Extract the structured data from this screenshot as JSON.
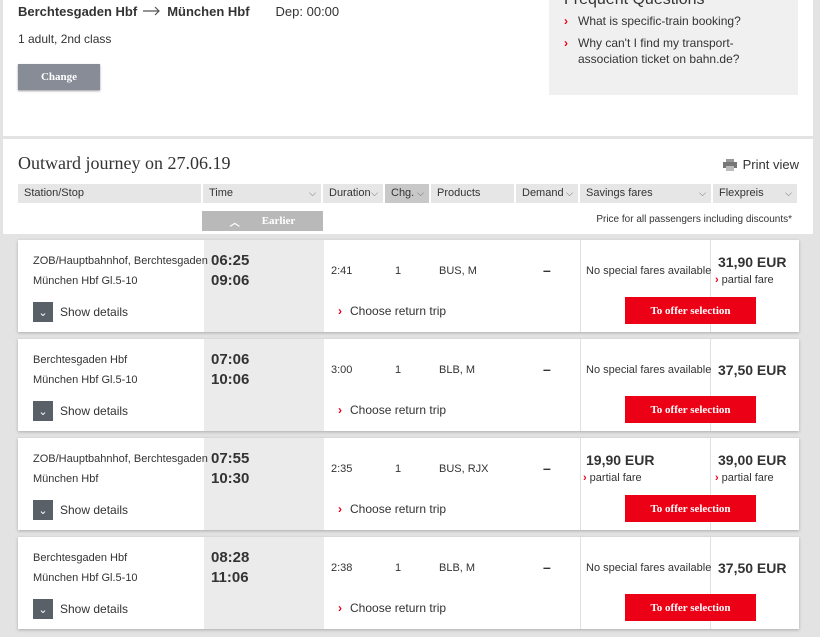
{
  "search": {
    "from": "Berchtesgaden Hbf",
    "to": "München Hbf",
    "dep_label": "Dep: 00:00",
    "passengers": "1 adult, 2nd class",
    "change_label": "Change"
  },
  "faq": {
    "title": "Frequent Questions",
    "items": [
      {
        "l1": "What is specific-train booking?",
        "l2": ""
      },
      {
        "l1": "Why can't I find my transport-",
        "l2": "association ticket on bahn.de?"
      }
    ]
  },
  "journey": {
    "title": "Outward journey on 27.06.19",
    "print_label": "Print view",
    "earlier_label": "Earlier",
    "price_note": "Price for all passengers including discounts*",
    "columns": [
      "Station/Stop",
      "Time",
      "Duration",
      "Chg.",
      "Products",
      "Demand",
      "Savings fares",
      "Flexpreis"
    ]
  },
  "labels": {
    "show_details": "Show details",
    "choose_return": "Choose return trip",
    "offer": "To offer selection",
    "no_fares": "No special fares available",
    "partial_fare": "partial fare"
  },
  "connections": [
    {
      "from": "ZOB/Hauptbahnhof, Berchtesgaden",
      "to": "München Hbf Gl.5-10",
      "dep": "06:25",
      "arr": "09:06",
      "duration": "2:41",
      "changes": "1",
      "products": "BUS, M",
      "demand": "–",
      "savings": "No special fares available",
      "flex": "31,90 EUR",
      "flex_partial": "partial fare"
    },
    {
      "from": "Berchtesgaden Hbf",
      "to": "München Hbf Gl.5-10",
      "dep": "07:06",
      "arr": "10:06",
      "duration": "3:00",
      "changes": "1",
      "products": "BLB, M",
      "demand": "–",
      "savings": "No special fares available",
      "flex": "37,50 EUR",
      "flex_partial": ""
    },
    {
      "from": "ZOB/Hauptbahnhof, Berchtesgaden",
      "to": "München Hbf",
      "dep": "07:55",
      "arr": "10:30",
      "duration": "2:35",
      "changes": "1",
      "products": "BUS, RJX",
      "demand": "–",
      "savings": "19,90 EUR",
      "savings_partial": "partial fare",
      "flex": "39,00 EUR",
      "flex_partial": "partial fare"
    },
    {
      "from": "Berchtesgaden Hbf",
      "to": "München Hbf Gl.5-10",
      "dep": "08:28",
      "arr": "11:06",
      "duration": "2:38",
      "changes": "1",
      "products": "BLB, M",
      "demand": "–",
      "savings": "No special fares available",
      "flex": "37,50 EUR",
      "flex_partial": ""
    }
  ],
  "colors": {
    "accent": "#ec0016",
    "button_gray": "#878c96"
  }
}
